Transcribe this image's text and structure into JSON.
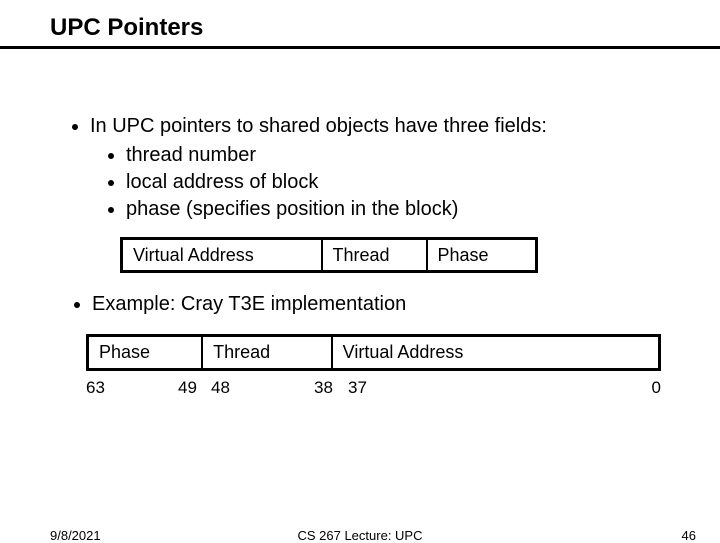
{
  "title": "UPC Pointers",
  "bullets": {
    "main": "In UPC pointers to shared objects have three fields:",
    "subs": {
      "a": "thread number",
      "b": "local address of block",
      "c": "phase (specifies position in the block)"
    },
    "example": "Example: Cray T3E implementation"
  },
  "table1": {
    "c1": "Virtual Address",
    "c2": "Thread",
    "c3": "Phase"
  },
  "table2": {
    "c1": "Phase",
    "c2": "Thread",
    "c3": "Virtual Address"
  },
  "bits": {
    "b63": "63",
    "b49": "49",
    "b48": "48",
    "b38": "38",
    "b37": "37",
    "b0": "0"
  },
  "footer": {
    "date": "9/8/2021",
    "center": "CS 267 Lecture: UPC",
    "page": "46"
  }
}
